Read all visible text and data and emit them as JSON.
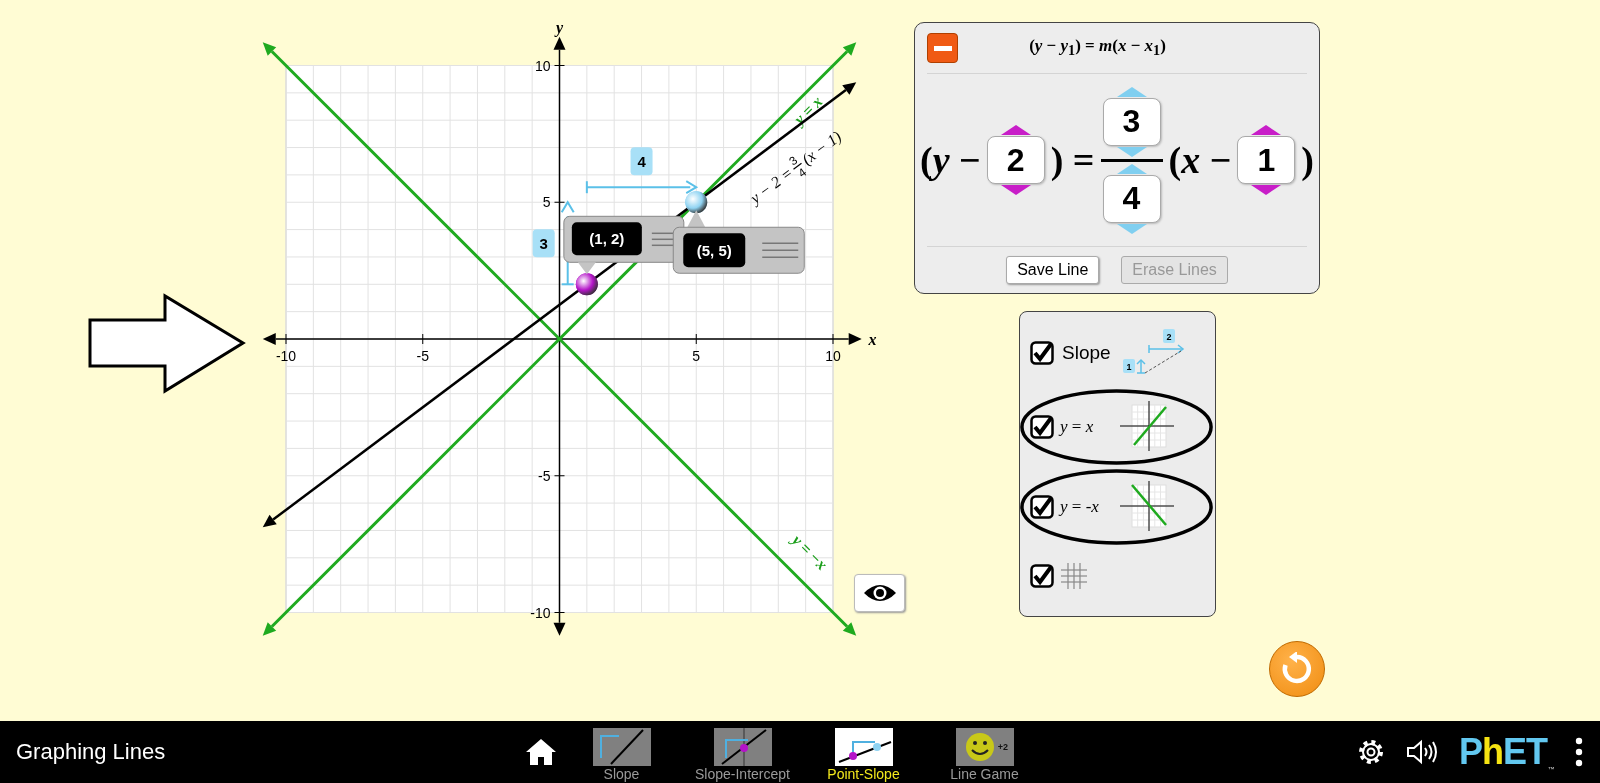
{
  "graph": {
    "x_axis_label": "x",
    "y_axis_label": "y",
    "x_tick_labels": [
      "-10",
      "-5",
      "5",
      "10"
    ],
    "y_tick_labels": [
      "10",
      "5",
      "-5",
      "-10"
    ],
    "slope_run_label": "4",
    "slope_rise_label": "3",
    "points": [
      {
        "label": "(1, 2)",
        "color": "#b414c8"
      },
      {
        "label": "(5, 5)",
        "color": "#8fd3f2"
      }
    ],
    "line_label": {
      "left": "y − 2 =",
      "numerator": "3",
      "denominator": "4",
      "right": "(x − 1)"
    },
    "reference_line_labels": [
      "y = x",
      "y = −x"
    ]
  },
  "pointer_arrow": {
    "shown": true
  },
  "equation_panel": {
    "expanded": true,
    "general_form": "(*y* − *y*$_{1}$) = *m*(*x* − *x*$_{1}$)",
    "parts": [
      {
        "kind": "text",
        "text": "(*y* −"
      },
      {
        "kind": "spinner",
        "value": "2",
        "color": "#c81ec8"
      },
      {
        "kind": "text",
        "text": ") ="
      },
      {
        "kind": "fraction",
        "numerator": "3",
        "denominator": "4",
        "color": "#80cff0"
      },
      {
        "kind": "text",
        "text": "(*x* −"
      },
      {
        "kind": "spinner",
        "value": "1",
        "color": "#c81ec8"
      },
      {
        "kind": "text",
        "text": ")"
      }
    ],
    "buttons": [
      {
        "label": "Save Line",
        "disabled": false
      },
      {
        "label": "Erase Lines",
        "disabled": true
      }
    ]
  },
  "options": {
    "items": [
      {
        "kind": "slope",
        "label": "Slope",
        "checked": true,
        "highlighted": false,
        "icon_labels": [
          "2",
          "1"
        ]
      },
      {
        "kind": "y-equals-x",
        "label": "*y* = *x*",
        "checked": true,
        "highlighted": true
      },
      {
        "kind": "y-equals-neg-x",
        "label": "*y* = -*x*",
        "checked": true,
        "highlighted": true
      },
      {
        "kind": "grid",
        "checked": true,
        "highlighted": false
      }
    ]
  },
  "navbar": {
    "title": "Graphing Lines",
    "screens": [
      {
        "kind": "slope",
        "label": "Slope",
        "selected": false
      },
      {
        "kind": "slope-intercept",
        "label": "Slope-Intercept",
        "selected": false
      },
      {
        "kind": "point-slope",
        "label": "Point-Slope",
        "selected": true
      },
      {
        "kind": "game",
        "label": "Line Game",
        "selected": false,
        "badge": "+2"
      }
    ],
    "logo": "PhET",
    "trademark": "™"
  }
}
